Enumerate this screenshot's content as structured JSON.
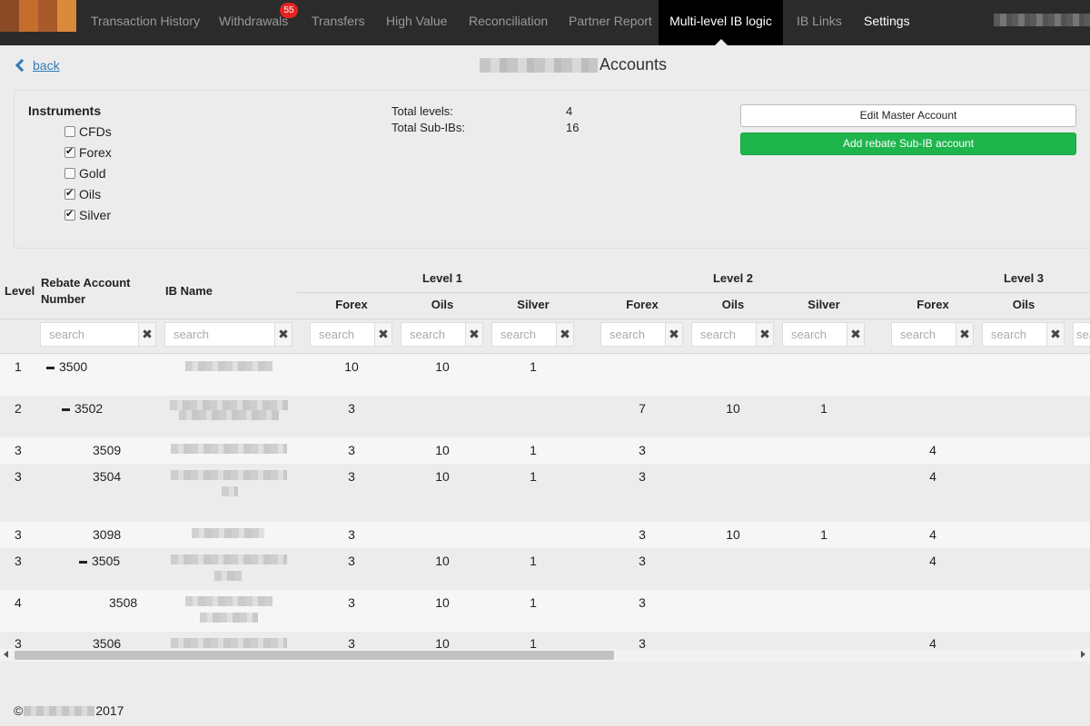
{
  "nav": {
    "items": [
      {
        "label": "Transaction History"
      },
      {
        "label": "Withdrawals",
        "badge": "55"
      },
      {
        "label": "Transfers"
      },
      {
        "label": "High Value"
      },
      {
        "label": "Reconciliation"
      },
      {
        "label": "Partner Report"
      },
      {
        "label": "Multi-level IB logic",
        "active": true
      },
      {
        "label": "IB Links"
      },
      {
        "label": "Settings"
      }
    ]
  },
  "header": {
    "back_label": "back",
    "title": "Accounts"
  },
  "instruments": {
    "title": "Instruments",
    "items": [
      {
        "label": "CFDs",
        "checked": false
      },
      {
        "label": "Forex",
        "checked": true
      },
      {
        "label": "Gold",
        "checked": false
      },
      {
        "label": "Oils",
        "checked": true
      },
      {
        "label": "Silver",
        "checked": true
      }
    ]
  },
  "stats": {
    "total_levels_label": "Total levels:",
    "total_levels": "4",
    "total_subibs_label": "Total Sub-IBs:",
    "total_subibs": "16"
  },
  "actions": {
    "edit_master": "Edit Master Account",
    "add_rebate": "Add rebate Sub-IB account"
  },
  "table": {
    "col_level": "Level",
    "col_rebate": "Rebate Account Number",
    "col_ibname": "IB Name",
    "groups": [
      "Level 1",
      "Level 2",
      "Level 3"
    ],
    "sub_cols": [
      "Forex",
      "Oils",
      "Silver",
      "Forex",
      "Oils",
      "Silver",
      "Forex",
      "Oils"
    ],
    "search_placeholder": "search",
    "rows": [
      {
        "level": "1",
        "account": "3500",
        "collapsible": true,
        "vals": [
          "10",
          "10",
          "1",
          "",
          "",
          "",
          "",
          ""
        ]
      },
      {
        "level": "2",
        "account": "3502",
        "collapsible": true,
        "vals": [
          "3",
          "",
          "",
          "7",
          "10",
          "1",
          "",
          ""
        ]
      },
      {
        "level": "3",
        "account": "3509",
        "collapsible": false,
        "vals": [
          "3",
          "10",
          "1",
          "3",
          "",
          "",
          "4",
          ""
        ]
      },
      {
        "level": "3",
        "account": "3504",
        "collapsible": false,
        "vals": [
          "3",
          "10",
          "1",
          "3",
          "",
          "",
          "4",
          ""
        ]
      },
      {
        "level": "3",
        "account": "3098",
        "collapsible": false,
        "vals": [
          "3",
          "",
          "",
          "3",
          "10",
          "1",
          "4",
          ""
        ]
      },
      {
        "level": "3",
        "account": "3505",
        "collapsible": true,
        "vals": [
          "3",
          "10",
          "1",
          "3",
          "",
          "",
          "4",
          ""
        ]
      },
      {
        "level": "4",
        "account": "3508",
        "collapsible": false,
        "vals": [
          "3",
          "10",
          "1",
          "3",
          "",
          "",
          "",
          ""
        ]
      },
      {
        "level": "3",
        "account": "3506",
        "collapsible": false,
        "vals": [
          "3",
          "10",
          "1",
          "3",
          "",
          "",
          "4",
          ""
        ]
      }
    ]
  },
  "footer": {
    "prefix": "©",
    "year": "2017"
  },
  "colors": {
    "active_nav": "#000000",
    "badge": "#e52222",
    "green_button": "#1fb54d",
    "link": "#337ab7"
  }
}
